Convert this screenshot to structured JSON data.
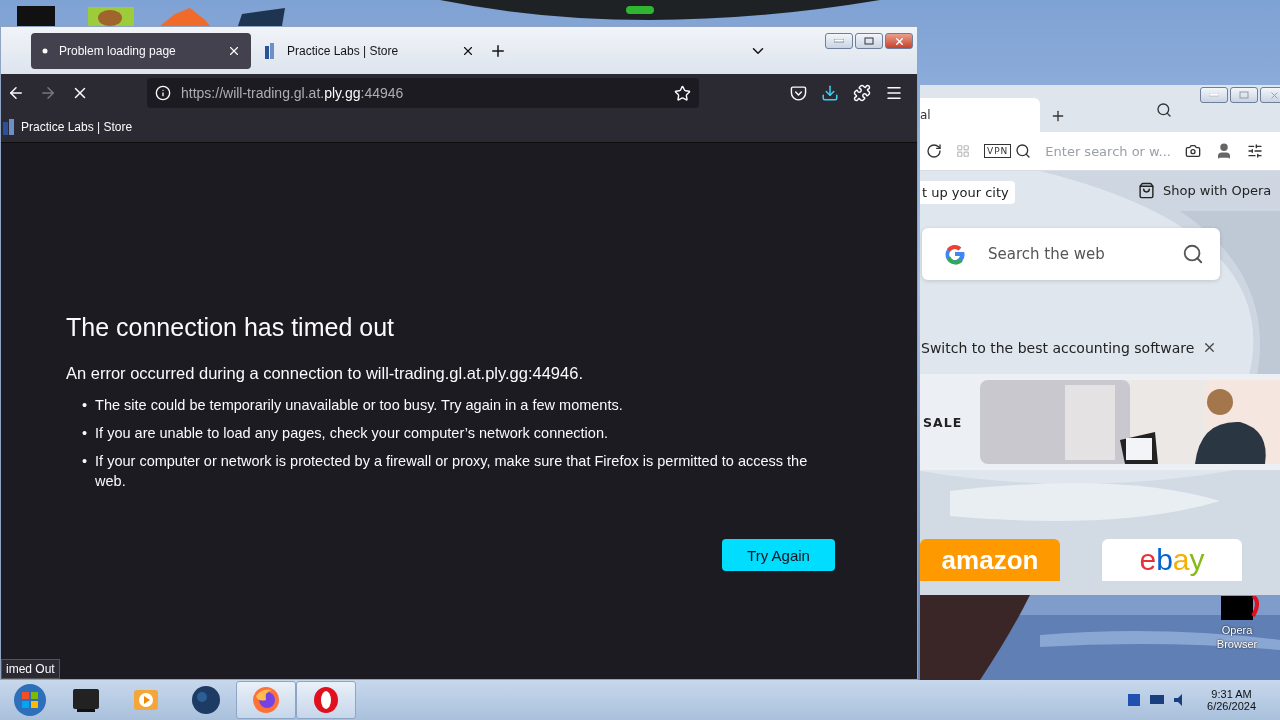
{
  "firefox": {
    "tabs": [
      {
        "title": "Problem loading page",
        "selected": true
      },
      {
        "title": "Practice Labs | Store",
        "selected": false
      }
    ],
    "url": {
      "before": "https://will-trading.gl.at.",
      "domain": "ply.gg",
      "after": ":44946"
    },
    "bookmarks": [
      "Practice Labs | Store"
    ],
    "error": {
      "title": "The connection has timed out",
      "description": "An error occurred during a connection to will-trading.gl.at.ply.gg:44946.",
      "bullet": "•",
      "bullets": [
        "The site could be temporarily unavailable or too busy. Try again in a few moments.",
        "If you are unable to load any pages, check your computer’s network connection.",
        "If your computer or network is protected by a firewall or proxy, make sure that Firefox is permitted to access the web."
      ],
      "button": "Try Again"
    },
    "status": "imed Out"
  },
  "opera": {
    "tab_title": "al",
    "vpn": "VPN",
    "address_placeholder": "Enter search or w...",
    "promo": "t up your city",
    "shop": "Shop with Opera",
    "search_placeholder": "Search the web",
    "ad": "Switch to the best accounting software",
    "sale": "SALE",
    "speed_dials": [
      {
        "kind": "amazon",
        "label": "amazon"
      },
      {
        "kind": "ebay",
        "label": "ebay"
      }
    ]
  },
  "desktop_icons": [
    {
      "label": "Opera Browser"
    }
  ],
  "taskbar": {
    "apps": [
      {
        "kind": "terminal",
        "open": false
      },
      {
        "kind": "media",
        "open": false
      },
      {
        "kind": "globe",
        "open": false
      },
      {
        "kind": "firefox",
        "open": true
      },
      {
        "kind": "opera",
        "open": true
      }
    ],
    "time": "9:31 AM",
    "date": "6/26/2024"
  }
}
